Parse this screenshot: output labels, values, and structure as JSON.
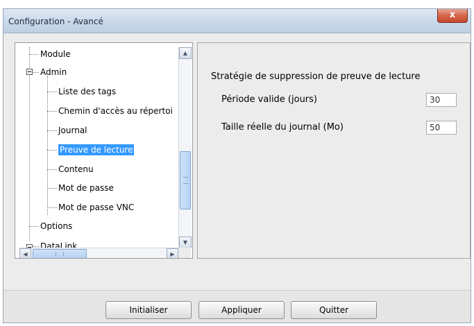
{
  "window": {
    "title": "Configuration - Avancé",
    "close_glyph": "x"
  },
  "tree": {
    "items": [
      {
        "label": "Module",
        "level": 0
      },
      {
        "label": "Admin",
        "level": 0,
        "expanded": true
      },
      {
        "label": "Liste des tags",
        "level": 1
      },
      {
        "label": "Chemin d'accès au répertoi",
        "level": 1
      },
      {
        "label": "Journal",
        "level": 1
      },
      {
        "label": "Preuve de lecture",
        "level": 1,
        "selected": true
      },
      {
        "label": "Contenu",
        "level": 1
      },
      {
        "label": "Mot de passe",
        "level": 1
      },
      {
        "label": "Mot de passe VNC",
        "level": 1
      },
      {
        "label": "Options",
        "level": 0
      },
      {
        "label": "DataLink",
        "level": 0,
        "expanded": true
      }
    ]
  },
  "settings": {
    "section_title": "Stratégie de suppression de preuve de lecture",
    "fields": [
      {
        "label": "Période valide (jours)",
        "value": "30"
      },
      {
        "label": "Taille réelle du journal (Mo)",
        "value": "50"
      }
    ]
  },
  "buttons": {
    "reset": "Initialiser",
    "apply": "Appliquer",
    "quit": "Quitter"
  },
  "colors": {
    "selection": "#3399ff",
    "close_button": "#c34a2e"
  }
}
